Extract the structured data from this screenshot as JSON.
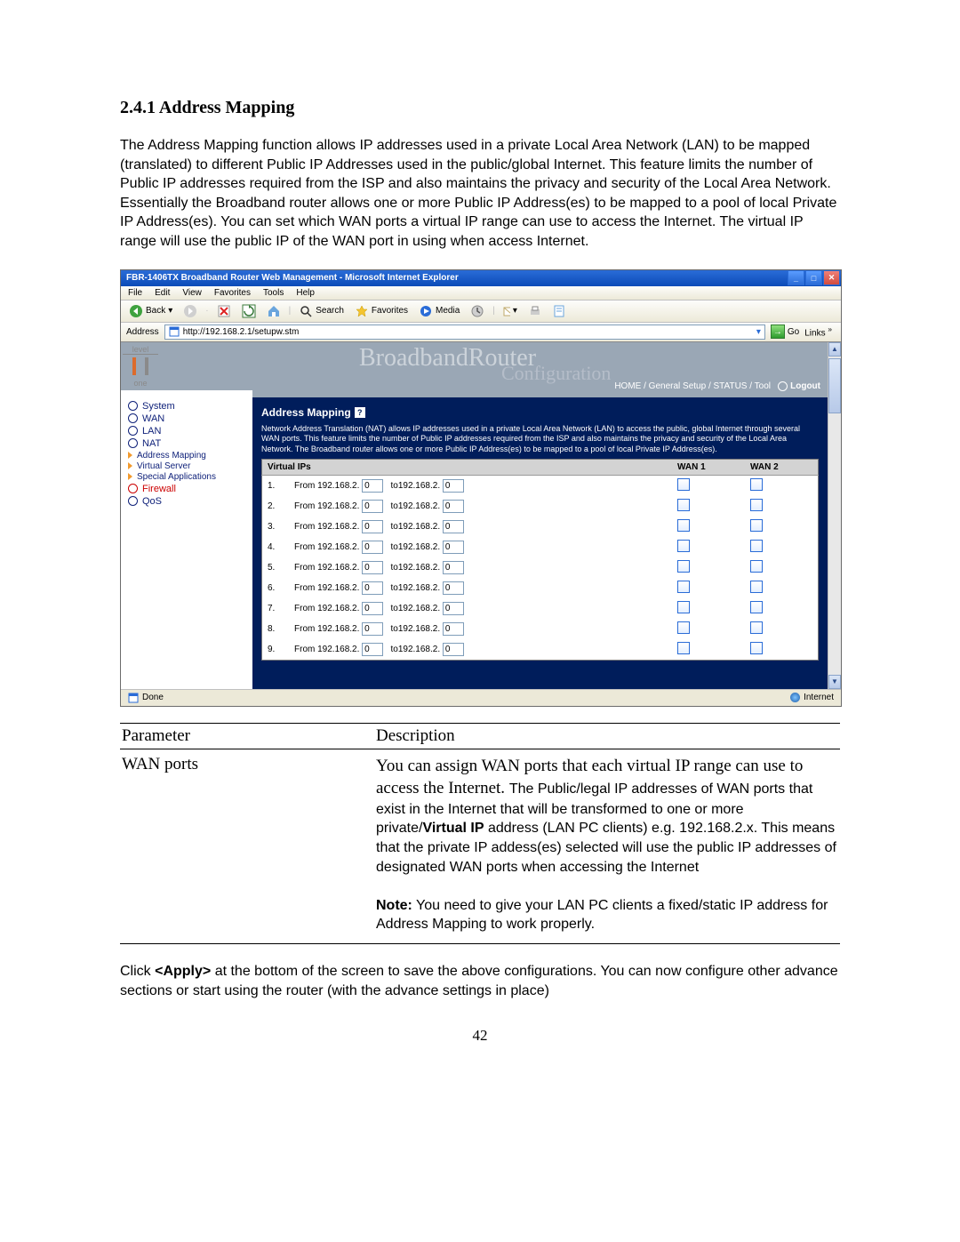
{
  "doc": {
    "heading": "2.4.1 Address Mapping",
    "intro": "The Address Mapping function allows IP addresses used in a private Local Area Network (LAN) to be mapped (translated) to different Public IP Addresses used in the public/global Internet. This feature limits the number of Public IP addresses required from the ISP and also maintains the privacy and security of the Local Area Network. Essentially the Broadband router allows one or more Public IP Address(es) to be mapped to a pool of local Private IP Address(es). You can set which WAN ports a virtual IP range can use to access the Internet. The virtual IP range will use the public IP of the WAN port in using when access Internet.",
    "param_header_left": "Parameter",
    "param_header_right": "Description",
    "param_row_name": "WAN ports",
    "param_row_desc_serif": "You can assign WAN ports that each virtual IP range can use to access the Internet. ",
    "param_row_desc_rest1": "The Public/legal IP addresses of WAN ports that exist in the Internet that will be transformed to one or more private/",
    "param_row_desc_bold": "Virtual IP",
    "param_row_desc_rest2": " address (LAN PC clients) e.g. 192.168.2.x. This means that the private IP addess(es) selected will use the public IP addresses of designated WAN ports when accessing the Internet",
    "param_note_label": "Note:",
    "param_note_text": " You need to give your LAN PC clients a fixed/static IP address for Address Mapping to work properly.",
    "footer": "Click <Apply> at the bottom of the screen to save the above configurations. You can now configure other advance sections or start using the router (with the advance settings in place)",
    "page_number": "42"
  },
  "browser": {
    "title": "FBR-1406TX Broadband Router Web Management - Microsoft Internet Explorer",
    "menus": [
      "File",
      "Edit",
      "View",
      "Favorites",
      "Tools",
      "Help"
    ],
    "back": "Back",
    "search": "Search",
    "favorites": "Favorites",
    "media": "Media",
    "address_label": "Address",
    "address_value": "http://192.168.2.1/setupw.stm",
    "go": "Go",
    "links": "Links",
    "status_done": "Done",
    "status_zone": "Internet"
  },
  "banner": {
    "logo_top": "level",
    "logo_bottom": "one",
    "big": "BroadbandRouter",
    "sub": "Configuration",
    "crumbs": {
      "home": "HOME",
      "setup": "General Setup",
      "status": "STATUS",
      "tool": "Tool",
      "logout": "Logout"
    }
  },
  "sidebar": {
    "system": "System",
    "wan": "WAN",
    "lan": "LAN",
    "nat": "NAT",
    "address_mapping": "Address Mapping",
    "virtual_server": "Virtual Server",
    "special_apps": "Special Applications",
    "firewall": "Firewall",
    "qos": "QoS"
  },
  "router": {
    "title": "Address Mapping",
    "desc": "Network Address Translation (NAT) allows IP addresses used in a private Local Area Network (LAN) to access the public, global Internet through several WAN ports. This feature limits the number of Public IP addresses required from the ISP and also maintains the privacy and security of the Local Area Network. The Broadband router allows one or more Public IP Address(es) to be mapped to a pool of local Private IP Address(es).",
    "col_vip": "Virtual IPs",
    "col_wan1": "WAN 1",
    "col_wan2": "WAN 2",
    "rows": [
      {
        "n": "1.",
        "from": "From 192.168.2.",
        "v1": "0",
        "to": "to192.168.2.",
        "v2": "0"
      },
      {
        "n": "2.",
        "from": "From 192.168.2.",
        "v1": "0",
        "to": "to192.168.2.",
        "v2": "0"
      },
      {
        "n": "3.",
        "from": "From 192.168.2.",
        "v1": "0",
        "to": "to192.168.2.",
        "v2": "0"
      },
      {
        "n": "4.",
        "from": "From 192.168.2.",
        "v1": "0",
        "to": "to192.168.2.",
        "v2": "0"
      },
      {
        "n": "5.",
        "from": "From 192.168.2.",
        "v1": "0",
        "to": "to192.168.2.",
        "v2": "0"
      },
      {
        "n": "6.",
        "from": "From 192.168.2.",
        "v1": "0",
        "to": "to192.168.2.",
        "v2": "0"
      },
      {
        "n": "7.",
        "from": "From 192.168.2.",
        "v1": "0",
        "to": "to192.168.2.",
        "v2": "0"
      },
      {
        "n": "8.",
        "from": "From 192.168.2.",
        "v1": "0",
        "to": "to192.168.2.",
        "v2": "0"
      },
      {
        "n": "9.",
        "from": "From 192.168.2.",
        "v1": "0",
        "to": "to192.168.2.",
        "v2": "0"
      }
    ]
  }
}
